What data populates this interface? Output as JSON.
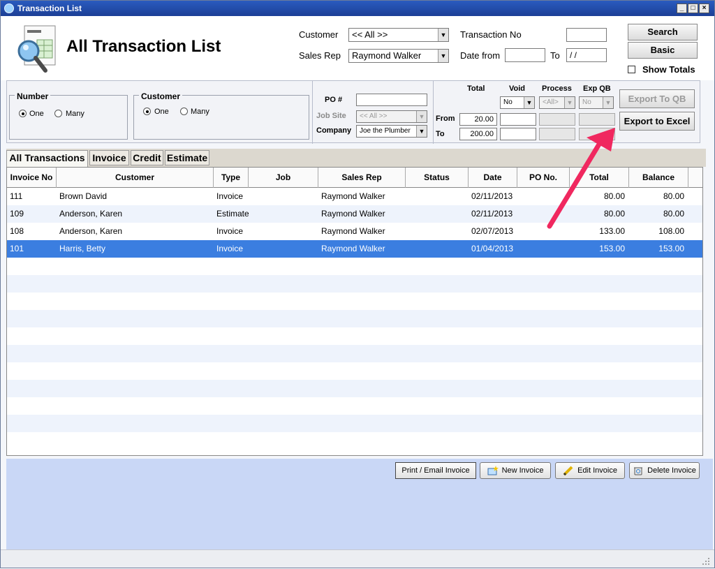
{
  "window": {
    "title": "Transaction List",
    "minimize": "_",
    "maximize": "□",
    "close": "×"
  },
  "header": {
    "page_title": "All Transaction List",
    "customer_label": "Customer",
    "customer_value": "<< All >>",
    "sales_rep_label": "Sales Rep",
    "sales_rep_value": "Raymond Walker",
    "transaction_no_label": "Transaction No",
    "transaction_no_value": "",
    "date_from_label": "Date from",
    "date_from_value": "",
    "date_to_label": "To",
    "date_to_value": " /  /",
    "search_button": "Search",
    "basic_button": "Basic",
    "show_totals_label": "Show Totals",
    "show_totals_checked": false
  },
  "filters": {
    "number_group": {
      "title": "Number",
      "options": [
        "One",
        "Many"
      ],
      "selected": "One"
    },
    "customer_group": {
      "title": "Customer",
      "options": [
        "One",
        "Many"
      ],
      "selected": "One"
    },
    "po_label": "PO #",
    "po_value": "",
    "job_site_label": "Job Site",
    "job_site_value": "<< All >>",
    "company_label": "Company",
    "company_value": "Joe the Plumber",
    "total_label": "Total",
    "void_label": "Void",
    "process_label": "Process",
    "exp_qb_label": "Exp QB",
    "from_label": "From",
    "to_label": "To",
    "total_from": "20.00",
    "total_to": "200.00",
    "void_value": "No",
    "process_value": "<All>",
    "exp_qb_value": "No",
    "export_qb_button": "Export To QB",
    "export_excel_button": "Export to Excel"
  },
  "tabs": [
    {
      "label": "All Transactions",
      "active": true
    },
    {
      "label": "Invoice",
      "active": false
    },
    {
      "label": "Credit",
      "active": false
    },
    {
      "label": "Estimate",
      "active": false
    }
  ],
  "grid": {
    "columns": [
      "Invoice No",
      "Customer",
      "Type",
      "Job",
      "Sales Rep",
      "Status",
      "Date",
      "PO No.",
      "Total",
      "Balance"
    ],
    "rows": [
      {
        "invoice_no": "111",
        "customer": "Brown David",
        "type": "Invoice",
        "job": "",
        "sales_rep": "Raymond Walker",
        "status": "",
        "date": "02/11/2013",
        "po_no": "",
        "total": "80.00",
        "balance": "80.00"
      },
      {
        "invoice_no": "109",
        "customer": "Anderson, Karen",
        "type": "Estimate",
        "job": "",
        "sales_rep": "Raymond Walker",
        "status": "",
        "date": "02/11/2013",
        "po_no": "",
        "total": "80.00",
        "balance": "80.00"
      },
      {
        "invoice_no": "108",
        "customer": "Anderson, Karen",
        "type": "Invoice",
        "job": "",
        "sales_rep": "Raymond Walker",
        "status": "",
        "date": "02/07/2013",
        "po_no": "",
        "total": "133.00",
        "balance": "108.00"
      },
      {
        "invoice_no": "101",
        "customer": "Harris, Betty",
        "type": "Invoice",
        "job": "",
        "sales_rep": "Raymond Walker",
        "status": "",
        "date": "01/04/2013",
        "po_no": "",
        "total": "153.00",
        "balance": "153.00"
      }
    ],
    "selected_row": 3
  },
  "actions": {
    "print_email": "Print / Email Invoice",
    "new_invoice": "New Invoice",
    "edit_invoice": "Edit Invoice",
    "delete_invoice": "Delete Invoice"
  },
  "colors": {
    "annotation_arrow": "#f0285f",
    "selection": "#3b7ee0",
    "titlebar": "#1c3f96"
  }
}
